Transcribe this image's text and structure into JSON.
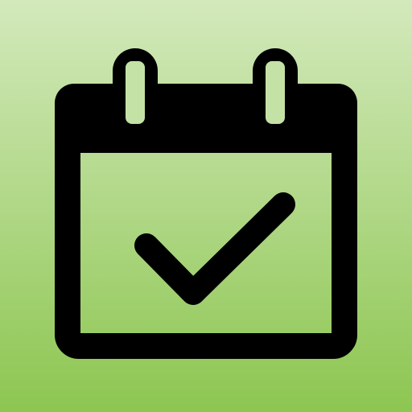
{
  "icon": {
    "name": "calendar-check-icon",
    "colors": {
      "background_top": "#d3e9bc",
      "background_bottom": "#8dc651",
      "stroke": "#000000",
      "ring_fill": "#c5e2a6"
    }
  }
}
